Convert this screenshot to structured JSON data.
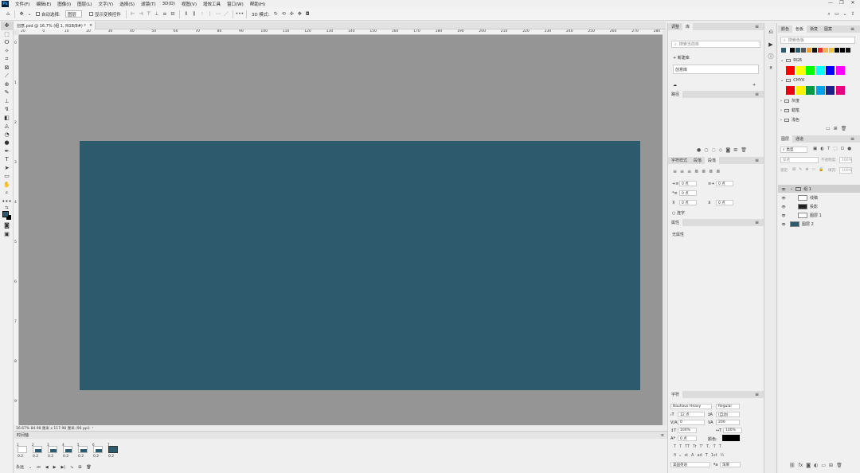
{
  "menu": {
    "logo": "Ps",
    "items": [
      "文件(F)",
      "编辑(E)",
      "图像(I)",
      "图层(L)",
      "文字(Y)",
      "选择(S)",
      "滤镜(T)",
      "3D(D)",
      "视图(V)",
      "增效工具",
      "窗口(W)",
      "帮助(H)"
    ],
    "window_controls": [
      "—",
      "❐",
      "✕"
    ]
  },
  "options": {
    "auto_select_label": "自动选择:",
    "auto_select_value": "图层",
    "show_transform_label": "显示变换控件",
    "mode_3d_label": "3D 模式:"
  },
  "document": {
    "tab_label": "创意.psd @ 16.7% (组 1, RGB/8#) *",
    "status": "16.67%   84.98 厘米 x 117.98 厘米 (96 ppi)"
  },
  "ruler_h": [
    "20",
    "0",
    "10",
    "20",
    "30",
    "40",
    "50",
    "60",
    "70",
    "80",
    "90",
    "100",
    "110",
    "120",
    "130",
    "140",
    "150",
    "160",
    "170",
    "180",
    "190",
    "200",
    "210",
    "220",
    "230",
    "240",
    "250",
    "260",
    "270",
    "280"
  ],
  "ruler_v": [
    "0",
    "1",
    "2",
    "3",
    "4",
    "5",
    "6",
    "7",
    "8",
    "9"
  ],
  "timeline": {
    "title": "时间轴",
    "frames": [
      {
        "num": "1",
        "dur": "0.2"
      },
      {
        "num": "2",
        "dur": "0.2"
      },
      {
        "num": "3",
        "dur": "0.2"
      },
      {
        "num": "4",
        "dur": "0.2"
      },
      {
        "num": "5",
        "dur": "0.2"
      },
      {
        "num": "6",
        "dur": "0.2"
      },
      {
        "num": "7",
        "dur": "0.2"
      }
    ],
    "loop_label": "永远"
  },
  "panels_mid": {
    "lib_tabs": [
      "调整",
      "库"
    ],
    "lib_search_placeholder": "搜索当前库",
    "new_library_label": "新建库",
    "library_item": "创意库",
    "paths_tab": "路径",
    "para_tabs": [
      "字符样式",
      "段落",
      "段落"
    ],
    "para_fields": [
      "0 点",
      "0 点",
      "0 点",
      "0 点",
      "0 点"
    ],
    "hyphen_label": "连字",
    "props_tab": "属性",
    "props_empty": "无属性",
    "char_tab": "字符",
    "font_family": "Bauhaus Heavy",
    "font_style": "Regular",
    "font_size": "12 点",
    "leading": "(自动)",
    "kerning": "0",
    "tracking": "200",
    "vscale": "100%",
    "hscale": "100%",
    "baseline": "0 点",
    "color_label": "颜色:",
    "lang": "美国英语",
    "aa": "浑厚",
    "typo_buttons": [
      "T",
      "T",
      "TT",
      "Tr",
      "T'",
      "T,",
      "T",
      "T"
    ]
  },
  "panels_right": {
    "swatch_tabs": [
      "颜色",
      "色板",
      "渐变",
      "图案"
    ],
    "swatch_search_placeholder": "搜索色板",
    "groups": [
      "RGB",
      "CMYK",
      "灰度",
      "蜡笔",
      "浅色"
    ],
    "layer_tabs": [
      "图层",
      "通道"
    ],
    "kind_label": "类型",
    "blend_mode": "穿透",
    "opacity_label": "不透明度:",
    "opacity": "100%",
    "lock_label": "锁定:",
    "fill_label": "填充:",
    "fill": "100%",
    "layers": [
      {
        "name": "组 1",
        "type": "group"
      },
      {
        "name": "线稿",
        "type": "layer"
      },
      {
        "name": "投影",
        "type": "layer"
      },
      {
        "name": "图层 1",
        "type": "layer"
      },
      {
        "name": "图层 2",
        "type": "layer"
      }
    ]
  },
  "colors": {
    "artboard": "#2e5a6e",
    "workspace": "#959595",
    "foreground": "#2c5a6f",
    "background": "#000000"
  }
}
